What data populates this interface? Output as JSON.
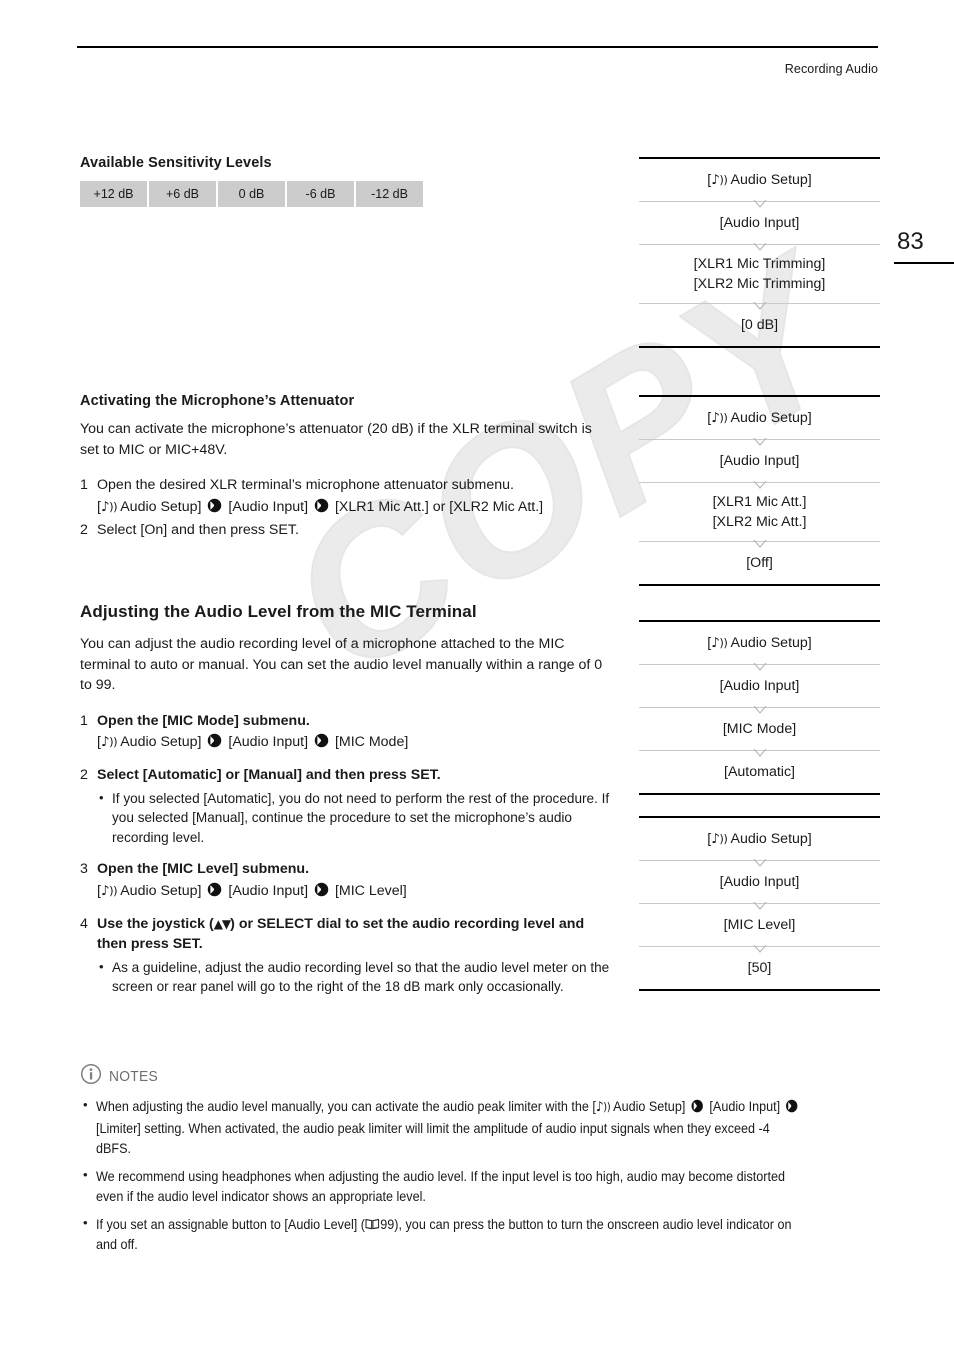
{
  "header": {
    "title": "Recording Audio",
    "page_number": "83"
  },
  "icons": {
    "audio_setup_note": "♪",
    "audio_setup_waves": "))",
    "arrow": "arrow-right-circle-icon",
    "info": "info-circle-icon",
    "book": "book-icon",
    "joystick_up": "▲",
    "joystick_down": "▼"
  },
  "sensitivity": {
    "heading": "Available Sensitivity Levels",
    "levels": [
      "+12 dB",
      "+6 dB",
      "0 dB",
      "-6 dB",
      "-12 dB"
    ]
  },
  "attenuator_section": {
    "heading": "Activating the Microphone’s Attenuator",
    "intro": "You can activate the microphone’s attenuator (20 dB) if the XLR terminal switch is set to MIC or MIC+48V.",
    "steps": [
      {
        "num": "1",
        "title": "Open the desired XLR terminal’s microphone attenuator submenu.",
        "path_prefix": "[",
        "path_1": " Audio Setup]",
        "path_2": "[Audio Input]",
        "path_3": "[XLR1 Mic Att.] or [XLR2 Mic Att.]"
      },
      {
        "num": "2",
        "title": "Select [On] and then press SET."
      }
    ]
  },
  "mic_level_section": {
    "heading": "Adjusting the Audio Level from the MIC Terminal",
    "intro": "You can adjust the audio recording level of a microphone attached to the MIC terminal to auto or manual. You can set the audio level manually within a range of 0 to 99.",
    "steps": [
      {
        "num": "1",
        "title": "Open the [MIC Mode] submenu.",
        "path_1": " Audio Setup]",
        "path_2": "[Audio Input]",
        "path_3": "[MIC Mode]"
      },
      {
        "num": "2",
        "title": "Select [Automatic] or [Manual] and then press SET.",
        "bullets": [
          "If you selected [Automatic], you do not need to perform the rest of the procedure. If you selected [Manual], continue the procedure to set the microphone’s audio recording level."
        ]
      },
      {
        "num": "3",
        "title": "Open the [MIC Level] submenu.",
        "path_1": " Audio Setup]",
        "path_2": "[Audio Input]",
        "path_3": "[MIC Level]"
      },
      {
        "num": "4",
        "title_a": "Use the joystick (",
        "title_b": ") or SELECT dial to set the audio recording level and then press SET.",
        "bullets": [
          "As a guideline, adjust the audio recording level so that the audio level meter on the screen or rear panel will go to the right of the 18 dB mark only occasionally."
        ]
      }
    ]
  },
  "menus": [
    {
      "name": "mic-trimming-menu",
      "rows": [
        {
          "lines": [
            "[♪)) Audio Setup]"
          ],
          "is_root": true
        },
        {
          "lines": [
            "[Audio Input]"
          ]
        },
        {
          "lines": [
            "[XLR1 Mic Trimming]",
            "[XLR2 Mic Trimming]"
          ]
        },
        {
          "lines": [
            "[0 dB]"
          ]
        }
      ]
    },
    {
      "name": "mic-att-menu",
      "rows": [
        {
          "lines": [
            "[♪)) Audio Setup]"
          ],
          "is_root": true
        },
        {
          "lines": [
            "[Audio Input]"
          ]
        },
        {
          "lines": [
            "[XLR1 Mic Att.]",
            "[XLR2 Mic Att.]"
          ]
        },
        {
          "lines": [
            "[Off]"
          ]
        }
      ]
    },
    {
      "name": "mic-mode-menu",
      "rows": [
        {
          "lines": [
            "[♪)) Audio Setup]"
          ],
          "is_root": true
        },
        {
          "lines": [
            "[Audio Input]"
          ]
        },
        {
          "lines": [
            "[MIC Mode]"
          ]
        },
        {
          "lines": [
            "[Automatic]"
          ]
        }
      ]
    },
    {
      "name": "mic-level-menu",
      "rows": [
        {
          "lines": [
            "[♪)) Audio Setup]"
          ],
          "is_root": true
        },
        {
          "lines": [
            "[Audio Input]"
          ]
        },
        {
          "lines": [
            "[MIC Level]"
          ]
        },
        {
          "lines": [
            "[50]"
          ]
        }
      ]
    }
  ],
  "menu_text": {
    "m0_r0": "Audio Setup]",
    "m0_r1": "[Audio Input]",
    "m0_r2a": "[XLR1 Mic Trimming]",
    "m0_r2b": "[XLR2 Mic Trimming]",
    "m0_r3": "[0 dB]",
    "m1_r0": "Audio Setup]",
    "m1_r1": "[Audio Input]",
    "m1_r2a": "[XLR1 Mic Att.]",
    "m1_r2b": "[XLR2 Mic Att.]",
    "m1_r3": "[Off]",
    "m2_r0": "Audio Setup]",
    "m2_r1": "[Audio Input]",
    "m2_r2": "[MIC Mode]",
    "m2_r3": "[Automatic]",
    "m3_r0": "Audio Setup]",
    "m3_r1": "[Audio Input]",
    "m3_r2": "[MIC Level]",
    "m3_r3": "[50]"
  },
  "notes": {
    "label": "NOTES",
    "items": [
      {
        "a": "When adjusting the audio level manually, you can activate the audio peak limiter with the [",
        "b": " Audio Setup]",
        "c": "[Audio Input]",
        "d": "[Limiter] setting. When activated, the audio peak limiter will limit the amplitude of audio input signals when they exceed -4 dBFS."
      },
      {
        "a": "We recommend using headphones when adjusting the audio level. If the input level is too high, audio may become distorted even if the audio level indicator shows an appropriate level."
      },
      {
        "a": "If you set an assignable button to [Audio Level] (",
        "page_ref": "99",
        "b": "), you can press the button to turn the onscreen audio level indicator on and off."
      }
    ]
  },
  "watermark": {
    "text": "COPY"
  },
  "colors": {
    "table_cell": "#cccccc",
    "rule": "#000000",
    "menu_separator": "#c9c9c9",
    "notes_gray": "#6e6e6e"
  }
}
